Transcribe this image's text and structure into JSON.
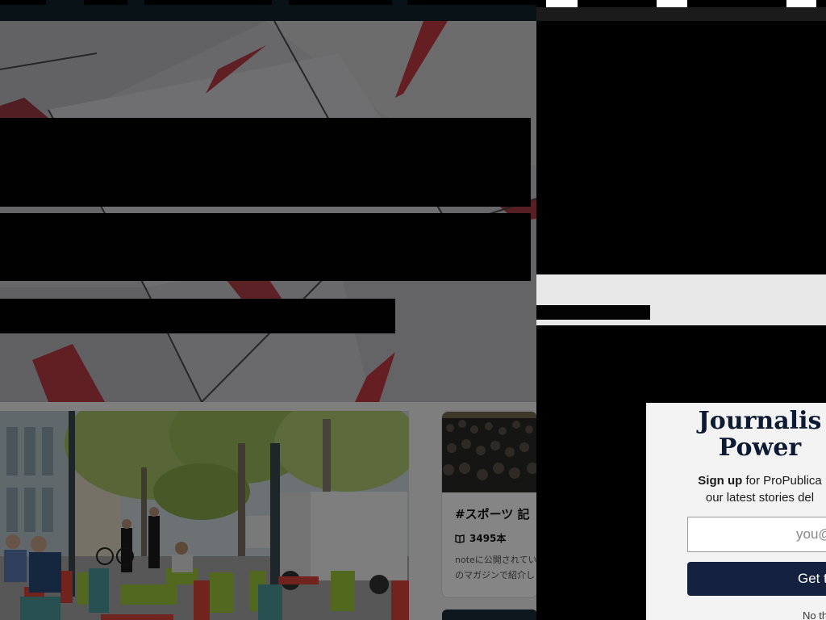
{
  "modal": {
    "title_line1": "Journalis",
    "title_line2": "Power",
    "body_bold": "Sign up",
    "body_rest": " for ProPublica",
    "body_line2": "our latest stories del",
    "email_placeholder": "you@",
    "button_label": "Get t",
    "dismiss_label": "No th"
  },
  "sports_card": {
    "title": "#スポーツ 記",
    "count": "3495本",
    "description_line1": "noteに公開されてい",
    "description_line2": "のマガジンで紹介し"
  },
  "icons": {
    "book": "book-icon"
  },
  "colors": {
    "nav_dark": "#13252c",
    "modal_button": "#14223f",
    "modal_title": "#0d1a33",
    "overlay": "rgba(0,0,0,0.48)"
  }
}
